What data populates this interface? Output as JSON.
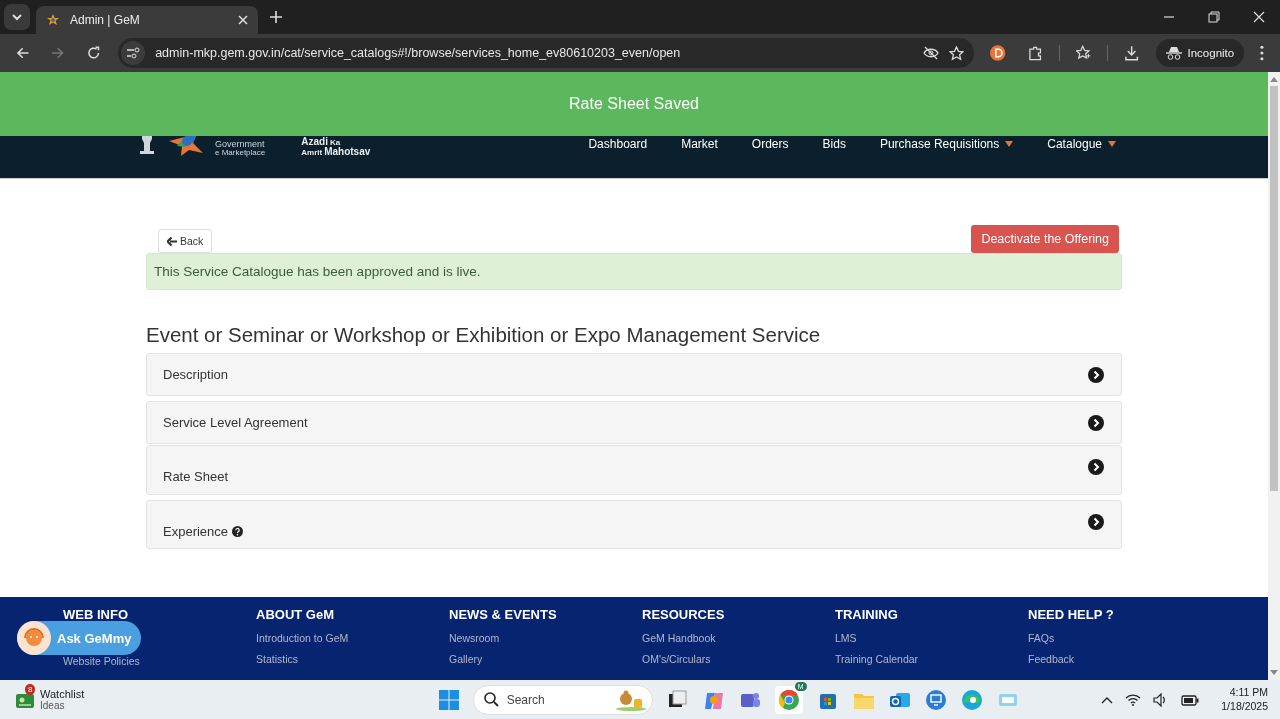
{
  "browser": {
    "tabs": [
      {
        "title": "Admin | GeM",
        "selected": true
      }
    ],
    "url": "admin-mkp.gem.gov.in/cat/service_catalogs#!/browse/services_home_ev80610203_even/open",
    "profile": "Incognito"
  },
  "toast": {
    "message": "Rate Sheet Saved"
  },
  "header": {
    "logo_lines": [
      "Government",
      "e Marketplace"
    ],
    "campaign_lines": [
      "Azadi",
      "Ka",
      "Amrit",
      "Mahotsav"
    ],
    "nav": [
      {
        "label": "Dashboard",
        "has_menu": false
      },
      {
        "label": "Market",
        "has_menu": false
      },
      {
        "label": "Orders",
        "has_menu": false
      },
      {
        "label": "Bids",
        "has_menu": false
      },
      {
        "label": "Purchase Requisitions",
        "has_menu": true
      },
      {
        "label": "Catalogue",
        "has_menu": true
      }
    ]
  },
  "back_button": "Back",
  "deactivate_button": "Deactivate the Offering",
  "alert": "This Service Catalogue has been approved and is live.",
  "title": "Event or Seminar or Workshop or Exhibition or Expo Management Service",
  "panels": [
    {
      "label": "Description",
      "help": false
    },
    {
      "label": "Service Level Agreement",
      "help": false
    },
    {
      "label": "Rate Sheet",
      "help": false
    },
    {
      "label": "Experience",
      "help": true
    }
  ],
  "footer": {
    "columns": [
      {
        "heading": "WEB INFO",
        "links": [
          "Website Policies"
        ]
      },
      {
        "heading": "ABOUT GeM",
        "links": [
          "Introduction to GeM",
          "Statistics"
        ]
      },
      {
        "heading": "NEWS & EVENTS",
        "links": [
          "Newsroom",
          "Gallery"
        ]
      },
      {
        "heading": "RESOURCES",
        "links": [
          "GeM Handbook",
          "OM's/Circulars"
        ]
      },
      {
        "heading": "TRAINING",
        "links": [
          "LMS",
          "Training Calendar"
        ]
      },
      {
        "heading": "NEED HELP ?",
        "links": [
          "FAQs",
          "Feedback"
        ]
      }
    ]
  },
  "chat_widget": {
    "label": "Ask GeMmy"
  },
  "taskbar": {
    "widget": {
      "badge": "8",
      "title": "Watchlist",
      "subtitle": "Ideas"
    },
    "search": {
      "placeholder": "Search"
    },
    "browser_badge": "M",
    "time": "4:11 PM",
    "date": "1/18/2025"
  }
}
